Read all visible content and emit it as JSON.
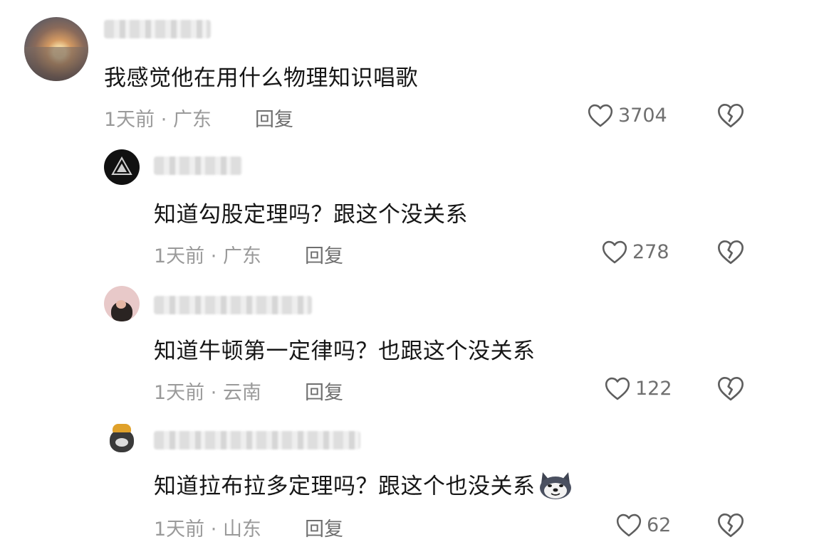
{
  "comments": [
    {
      "text": "我感觉他在用什么物理知识唱歌",
      "time": "1天前",
      "location": "广东",
      "reply": "回复",
      "likes": "3704"
    },
    {
      "text": "知道勾股定理吗？跟这个没关系",
      "time": "1天前",
      "location": "广东",
      "reply": "回复",
      "likes": "278"
    },
    {
      "text": "知道牛顿第一定律吗？也跟这个没关系",
      "time": "1天前",
      "location": "云南",
      "reply": "回复",
      "likes": "122"
    },
    {
      "text": "知道拉布拉多定理吗？跟这个也没关系",
      "time": "1天前",
      "location": "山东",
      "reply": "回复",
      "likes": "62",
      "emoji": "husky-dog-emoji"
    }
  ],
  "meta_separator": " · ",
  "icons": {
    "like": "heart-outline-icon",
    "dislike": "broken-heart-icon"
  },
  "colors": {
    "text": "#161616",
    "meta": "#9a9a9a",
    "action": "#6f6f6f"
  }
}
